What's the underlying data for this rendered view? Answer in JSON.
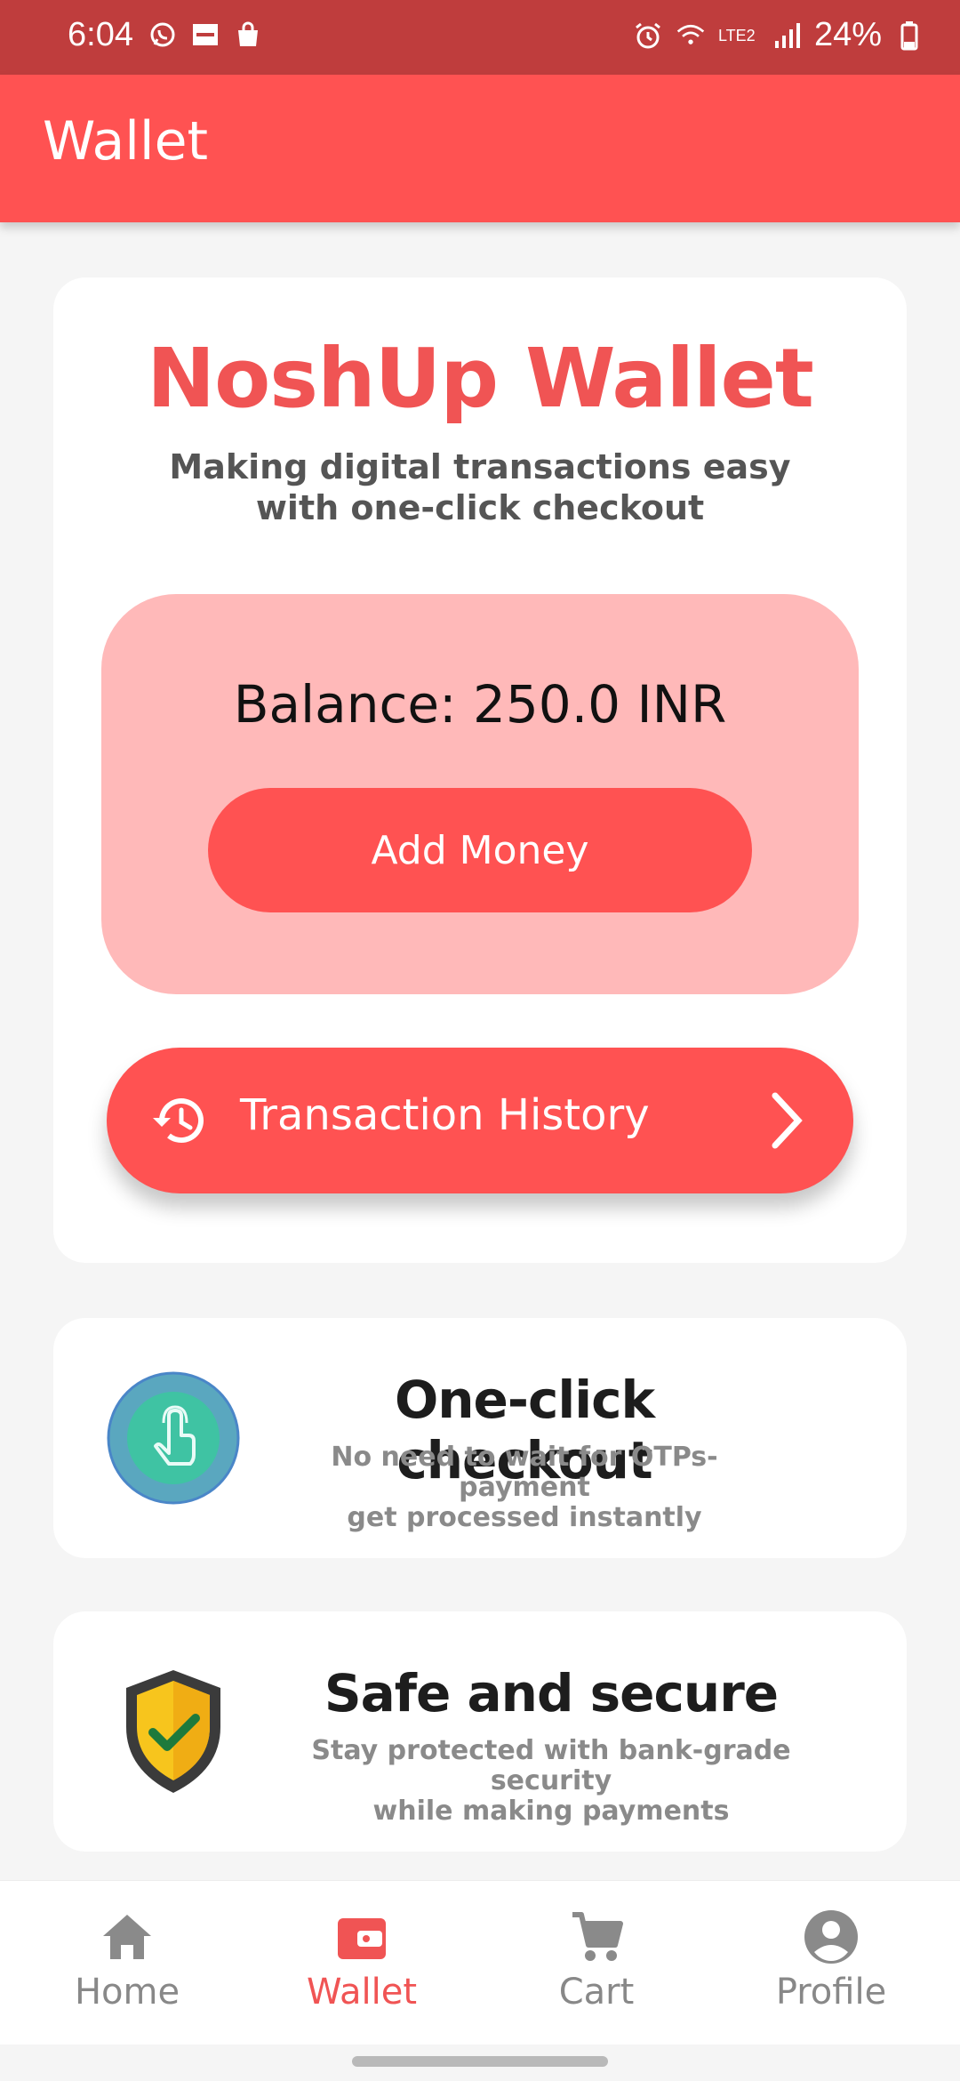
{
  "status_bar": {
    "time": "6:04",
    "battery": "24%",
    "network": "LTE2",
    "icons_left": [
      "whatsapp-icon",
      "zomato-icon",
      "shopping-bag-icon"
    ],
    "icons_right": [
      "alarm-icon",
      "wifi-icon",
      "volte-icon",
      "signal-icon",
      "battery-icon"
    ]
  },
  "app_bar": {
    "title": "Wallet"
  },
  "wallet_card": {
    "title": "NoshUp Wallet",
    "subtitle_line1": "Making digital transactions easy",
    "subtitle_line2": "with one-click checkout",
    "balance_text": "Balance: 250.0 INR",
    "add_money_label": "Add Money",
    "transaction_history_label": "Transaction History"
  },
  "features": [
    {
      "title": "One-click checkout",
      "desc_line1": "No need to wait for OTPs-payment",
      "desc_line2": "get processed instantly",
      "icon": "touch-icon"
    },
    {
      "title": "Safe and secure",
      "desc_line1": "Stay protected with bank-grade security",
      "desc_line2": "while making payments",
      "icon": "shield-check-icon"
    }
  ],
  "bottom_nav": {
    "items": [
      {
        "label": "Home",
        "icon": "home-icon"
      },
      {
        "label": "Wallet",
        "icon": "wallet-icon",
        "active": true
      },
      {
        "label": "Cart",
        "icon": "cart-icon"
      },
      {
        "label": "Profile",
        "icon": "profile-icon"
      }
    ]
  },
  "colors": {
    "primary": "#ff5252",
    "status_bar": "#bf3d3d",
    "balance_bg": "#ffb9b9",
    "accent_text": "#f05454"
  }
}
